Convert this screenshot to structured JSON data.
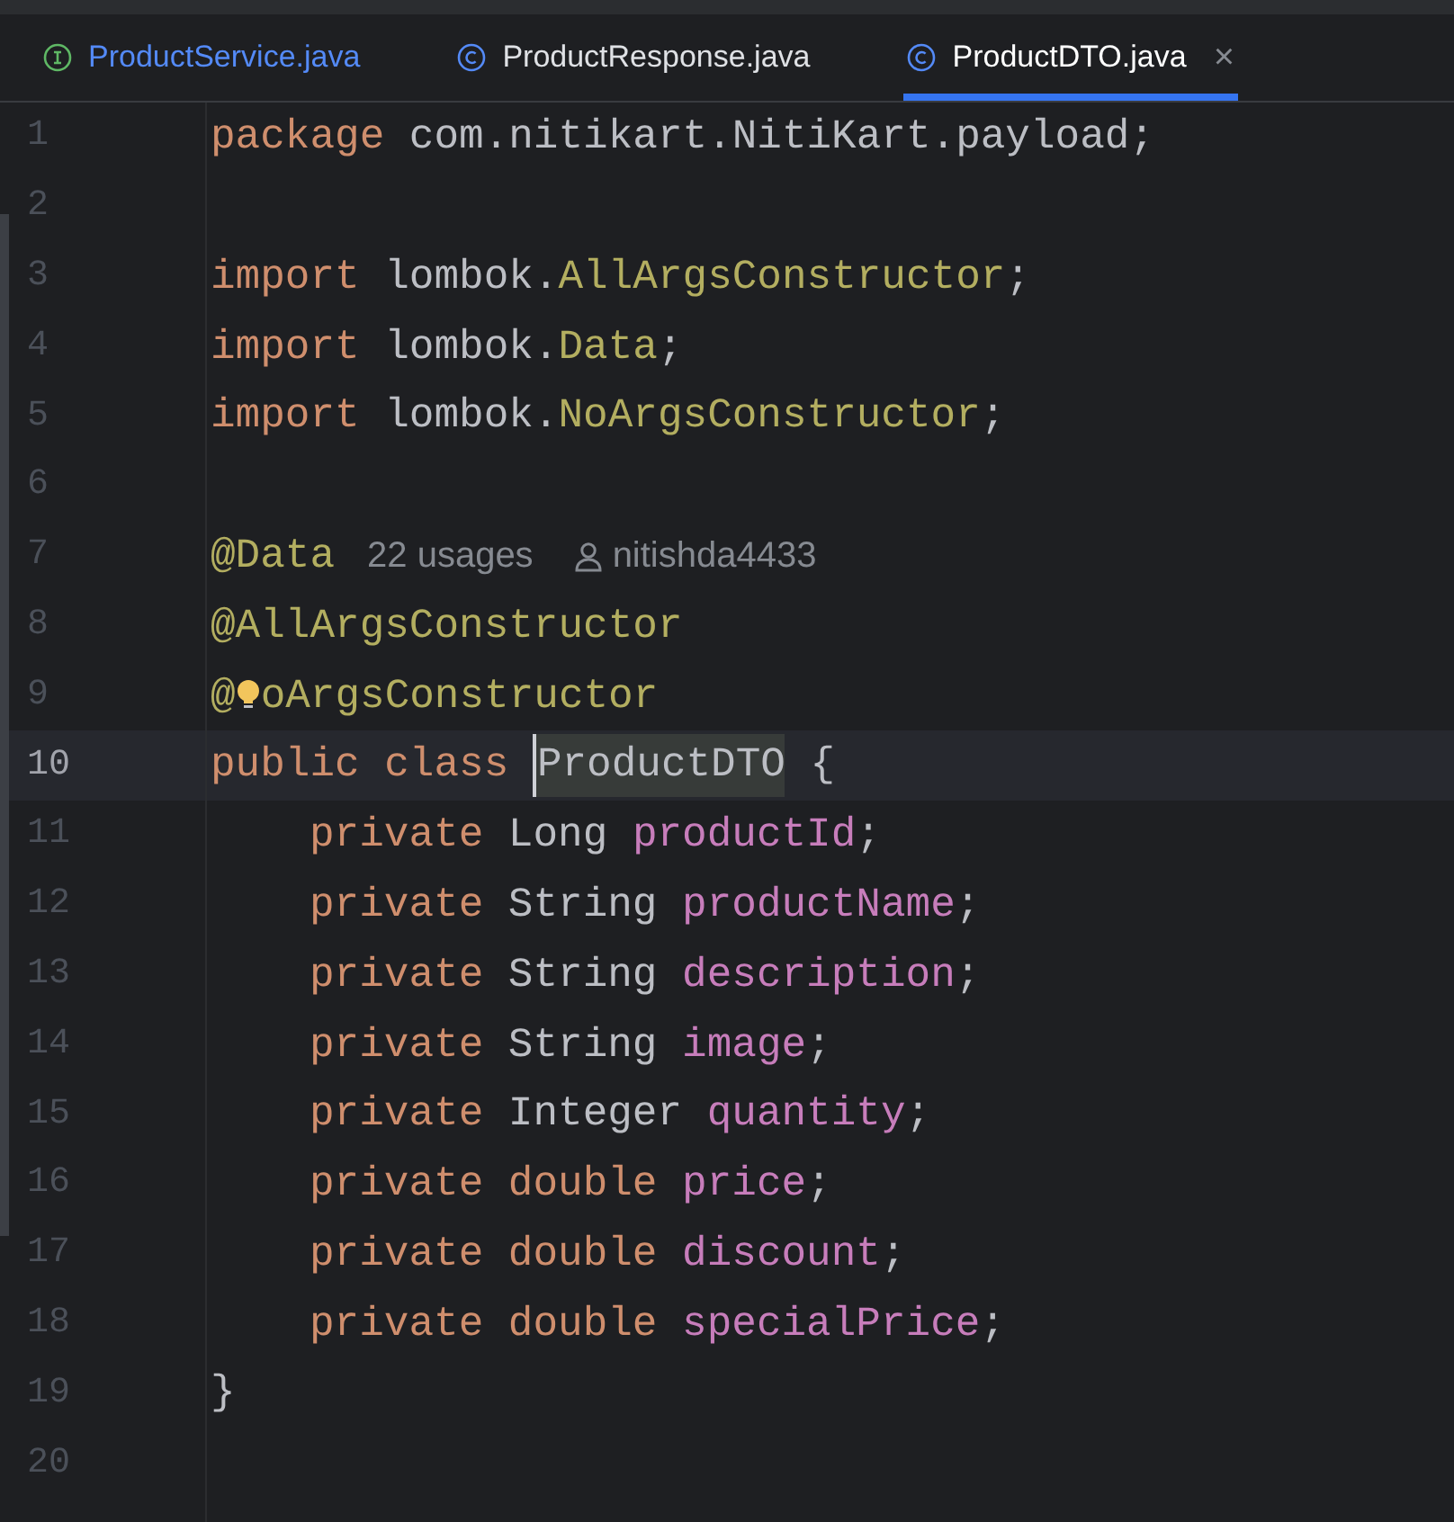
{
  "tabs": [
    {
      "label": "ProductService.java",
      "kind": "interface",
      "color": "#548af7",
      "selected": false
    },
    {
      "label": "ProductResponse.java",
      "kind": "class",
      "color": "#dfe1e5",
      "selected": false
    },
    {
      "label": "ProductDTO.java",
      "kind": "class",
      "color": "#ffffff",
      "selected": true,
      "close_glyph": "×"
    }
  ],
  "lines": [
    {
      "number": "1",
      "current": false,
      "tokens": [
        {
          "text": "package ",
          "kind": "keyword"
        },
        {
          "text": "com.nitikart.NitiKart.payload;",
          "kind": "plain"
        }
      ]
    },
    {
      "number": "2",
      "current": false
    },
    {
      "number": "3",
      "current": false,
      "tokens": [
        {
          "text": "import ",
          "kind": "keyword"
        },
        {
          "text": "lombok.",
          "kind": "plain"
        },
        {
          "text": "AllArgsConstructor",
          "kind": "annotation"
        },
        {
          "text": ";",
          "kind": "plain"
        }
      ]
    },
    {
      "number": "4",
      "current": false,
      "tokens": [
        {
          "text": "import ",
          "kind": "keyword"
        },
        {
          "text": "lombok.",
          "kind": "plain"
        },
        {
          "text": "Data",
          "kind": "annotation"
        },
        {
          "text": ";",
          "kind": "plain"
        }
      ]
    },
    {
      "number": "5",
      "current": false,
      "tokens": [
        {
          "text": "import ",
          "kind": "keyword"
        },
        {
          "text": "lombok.",
          "kind": "plain"
        },
        {
          "text": "NoArgsConstructor",
          "kind": "annotation"
        },
        {
          "text": ";",
          "kind": "plain"
        }
      ]
    },
    {
      "number": "6",
      "current": false
    },
    {
      "number": "7",
      "current": false,
      "tokens": [
        {
          "text": "@Data",
          "kind": "annotation"
        },
        {
          "text": "22 usages",
          "kind": "hint"
        },
        {
          "text": "nitishda4433",
          "kind": "author"
        }
      ]
    },
    {
      "number": "8",
      "current": false,
      "tokens": [
        {
          "text": "@AllArgsConstructor",
          "kind": "annotation"
        }
      ]
    },
    {
      "number": "9",
      "current": false,
      "tokens": [
        {
          "text": "@",
          "kind": "annotation"
        },
        {
          "kind": "bulb"
        },
        {
          "text": "oArgsConstructor",
          "kind": "annotation"
        }
      ]
    },
    {
      "number": "10",
      "current": true,
      "tokens": [
        {
          "text": "public class ",
          "kind": "keyword"
        },
        {
          "text": "ProductDTO",
          "kind": "highlighted"
        },
        {
          "text": " {",
          "kind": "plain"
        }
      ]
    },
    {
      "number": "11",
      "indented": true,
      "current": false,
      "tokens": [
        {
          "text": "private ",
          "kind": "keyword"
        },
        {
          "text": "Long ",
          "kind": "plain"
        },
        {
          "text": "productId",
          "kind": "field"
        },
        {
          "text": ";",
          "kind": "plain"
        }
      ]
    },
    {
      "number": "12",
      "indented": true,
      "current": false,
      "tokens": [
        {
          "text": "private ",
          "kind": "keyword"
        },
        {
          "text": "String ",
          "kind": "plain"
        },
        {
          "text": "productName",
          "kind": "field"
        },
        {
          "text": ";",
          "kind": "plain"
        }
      ]
    },
    {
      "number": "13",
      "indented": true,
      "current": false,
      "tokens": [
        {
          "text": "private ",
          "kind": "keyword"
        },
        {
          "text": "String ",
          "kind": "plain"
        },
        {
          "text": "description",
          "kind": "field"
        },
        {
          "text": ";",
          "kind": "plain"
        }
      ]
    },
    {
      "number": "14",
      "indented": true,
      "current": false,
      "tokens": [
        {
          "text": "private ",
          "kind": "keyword"
        },
        {
          "text": "String ",
          "kind": "plain"
        },
        {
          "text": "image",
          "kind": "field"
        },
        {
          "text": ";",
          "kind": "plain"
        }
      ]
    },
    {
      "number": "15",
      "indented": true,
      "current": false,
      "tokens": [
        {
          "text": "private ",
          "kind": "keyword"
        },
        {
          "text": "Integer ",
          "kind": "plain"
        },
        {
          "text": "quantity",
          "kind": "field"
        },
        {
          "text": ";",
          "kind": "plain"
        }
      ]
    },
    {
      "number": "16",
      "indented": true,
      "current": false,
      "tokens": [
        {
          "text": "private double ",
          "kind": "keyword"
        },
        {
          "text": "price",
          "kind": "field"
        },
        {
          "text": ";",
          "kind": "plain"
        }
      ]
    },
    {
      "number": "17",
      "indented": true,
      "current": false,
      "tokens": [
        {
          "text": "private double ",
          "kind": "keyword"
        },
        {
          "text": "discount",
          "kind": "field"
        },
        {
          "text": ";",
          "kind": "plain"
        }
      ]
    },
    {
      "number": "18",
      "indented": true,
      "current": false,
      "tokens": [
        {
          "text": "private double ",
          "kind": "keyword"
        },
        {
          "text": "specialPrice",
          "kind": "field"
        },
        {
          "text": ";",
          "kind": "plain"
        }
      ]
    },
    {
      "number": "19",
      "current": false,
      "tokens": [
        {
          "text": "}",
          "kind": "plain"
        }
      ]
    },
    {
      "number": "20",
      "current": false
    }
  ]
}
